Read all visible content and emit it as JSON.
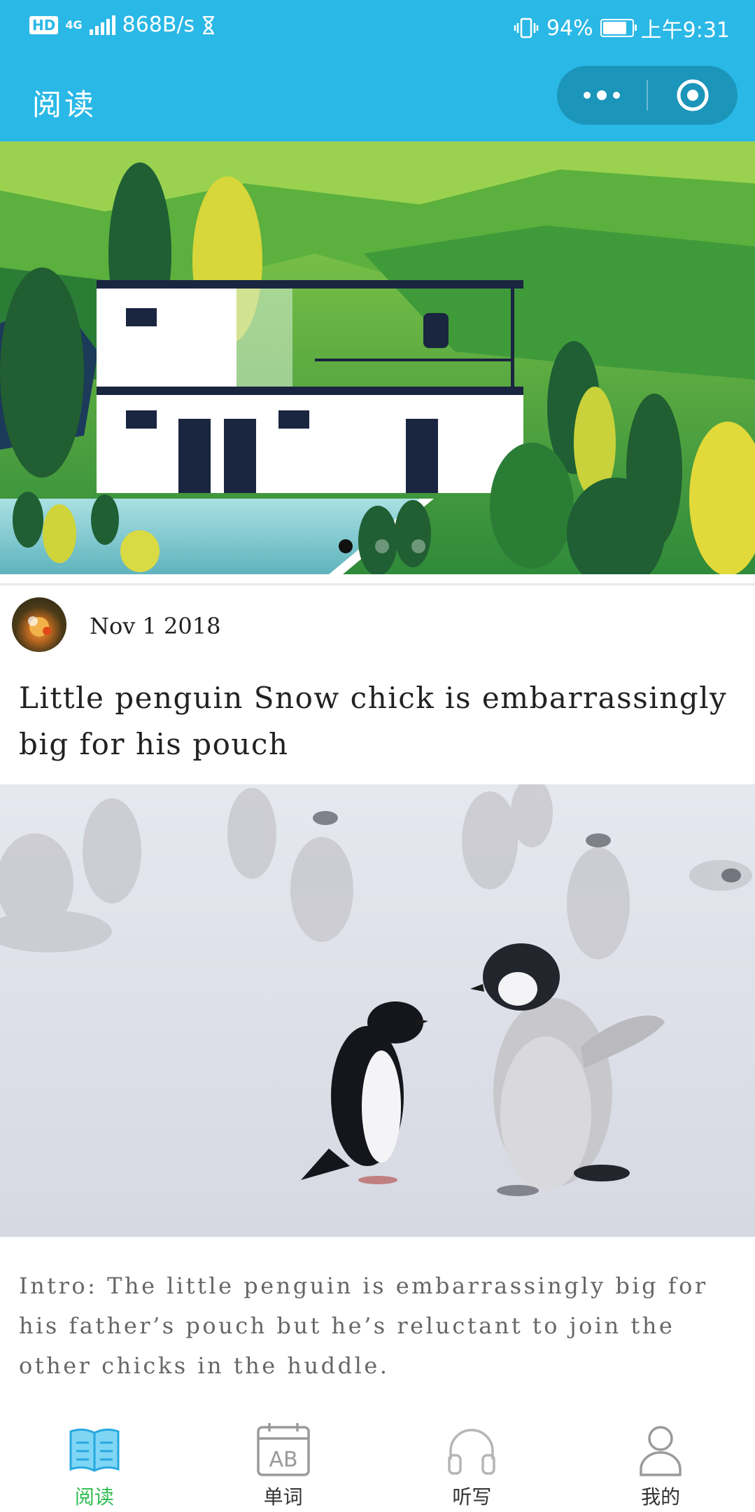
{
  "status_bar": {
    "hd": "HD",
    "network": "4G",
    "speed": "868B/s",
    "battery": "94%",
    "battery_level": 0.94,
    "time": "上午9:31"
  },
  "header": {
    "title": "阅读"
  },
  "banner": {
    "slide_count": 3,
    "active_slide": 1
  },
  "article": {
    "date": "Nov 1 2018",
    "title": "Little penguin Snow chick is embarrassingly big for his pouch",
    "intro": "Intro: The little penguin is embarrassingly big for his father’s pouch but he’s reluctant to join the other chicks in the huddle."
  },
  "tabs": [
    {
      "label": "阅读",
      "icon": "book-icon",
      "active": true
    },
    {
      "label": "单词",
      "icon": "calendar-ab-icon",
      "active": false
    },
    {
      "label": "听写",
      "icon": "headphones-icon",
      "active": false
    },
    {
      "label": "我的",
      "icon": "user-icon",
      "active": false
    }
  ],
  "colors": {
    "header": "#2ab8e6",
    "active_tab": "#2dbb4f",
    "inactive_tab": "#9a9a9a"
  }
}
